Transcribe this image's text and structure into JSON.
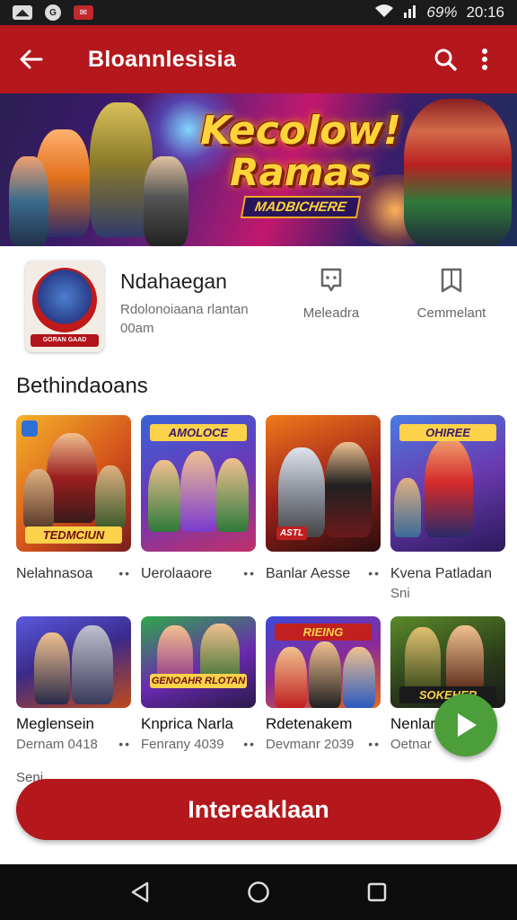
{
  "status_bar": {
    "battery": "69%",
    "time": "20:16"
  },
  "app_bar": {
    "title": "Bloannlesisia"
  },
  "banner": {
    "title_line1": "Kecolow!",
    "title_line2": "Ramas",
    "subtitle": "MADBICHERE"
  },
  "app": {
    "name": "Ndahaegan",
    "developer": "Rdolonoiaana rlantan",
    "size": "00am",
    "logo_text": "GORAN GAAD",
    "meta": [
      {
        "label": "Meleadra",
        "icon": "chat-icon"
      },
      {
        "label": "Cemmelant",
        "icon": "book-icon"
      }
    ]
  },
  "section": {
    "title": "Bethindaoans"
  },
  "row1": [
    {
      "title": "Nelahnasoa",
      "badge": "TEDMCIUN"
    },
    {
      "title": "Uerolaaore",
      "badge": "AMOLOCE"
    },
    {
      "title": "Banlar Aesse",
      "badge": "ASTL"
    },
    {
      "title": "Kvena Patladan",
      "sub": "Sni",
      "badge": "OHIREE"
    }
  ],
  "row2": [
    {
      "title": "Meglensein",
      "sub": "Dernam 0418",
      "badge": ""
    },
    {
      "title": "Knprica Narla",
      "sub": "Fenrany 4039",
      "badge": "GENOAHR RLOTAN"
    },
    {
      "title": "Rdetenakem",
      "sub": "Devmanr 2039",
      "badge": "RIEING"
    },
    {
      "title": "Nenlar",
      "sub": "Oetnar",
      "badge": "SOKEHER"
    }
  ],
  "footer": {
    "small_label": "Seni",
    "install_label": "Intereaklaan"
  },
  "colors": {
    "primary": "#b4171c",
    "fab": "#4b9e3a"
  }
}
